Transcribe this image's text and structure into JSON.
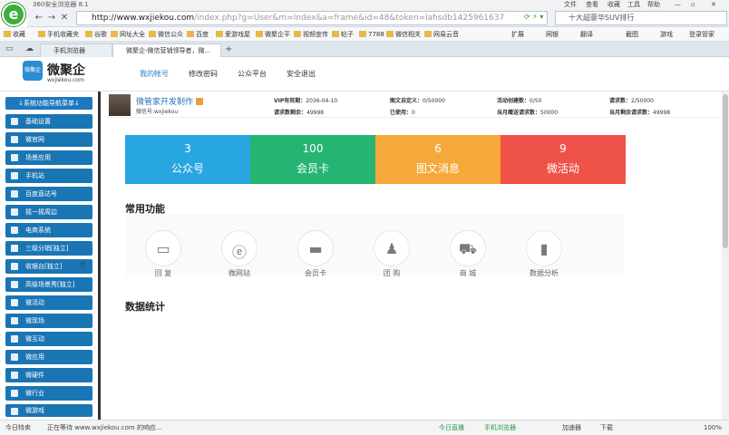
{
  "titlebar": {
    "app_title": "360安全浏览器 8.1",
    "menus": [
      "文件",
      "查看",
      "收藏",
      "工具",
      "帮助"
    ]
  },
  "browser": {
    "url_host": "http://www.wxjiekou.com",
    "url_path": "/index.php?g=User&m=Index&a=frame&id=48&token=lahsdb1425961637",
    "search_text": "十大超豪华SUV排行",
    "bookmarks": [
      "收藏",
      "手机收藏夹",
      "谷歌",
      "网址大全",
      "微信公众",
      "百度",
      "爱游戏屋",
      "微聚企平",
      "视频宣传",
      "帖子",
      "7788",
      "微信相关",
      "网易云音"
    ],
    "right_tools": [
      "扩展",
      "网银",
      "翻译",
      "截图",
      "游戏",
      "登录管家"
    ],
    "tabs": [
      {
        "label": "手机浏览器"
      },
      {
        "label": "微聚企-微信营销领导者，微..."
      }
    ]
  },
  "site": {
    "brand_badge": "微聚企",
    "brand_name": "微聚企",
    "brand_url": "wxjiekou.com",
    "nav": [
      "我的帐号",
      "修改密码",
      "公众平台",
      "安全退出"
    ]
  },
  "sidebar": {
    "header": "↓系统功能导航菜单↓",
    "items": [
      "基础设置",
      "微官网",
      "场景应用",
      "手机站",
      "百度直达号",
      "摇一摇周边",
      "电商系统",
      "三级分销[独立]",
      "收银台[独立]",
      "高级场景秀[独立]",
      "微活动",
      "微现场",
      "微互动",
      "微应用",
      "微硬件",
      "微行业",
      "微游戏"
    ]
  },
  "account": {
    "name": "微管家开发制作",
    "wx_id": "微信号:wxjiekou",
    "stats": [
      {
        "label": "VIP有效期：",
        "value": "2036-04-10"
      },
      {
        "label": "请求数剩余：",
        "value": "49998"
      },
      {
        "label": "图文自定义：",
        "value": "0/50000"
      },
      {
        "label": "已使用：",
        "value": "0"
      },
      {
        "label": "活动创建数：",
        "value": "0/50"
      },
      {
        "label": "当月赠送请求数：",
        "value": "50000"
      },
      {
        "label": "请求数：",
        "value": "2/50000"
      },
      {
        "label": "当月剩余请求数：",
        "value": "49998"
      }
    ]
  },
  "summary_cards": [
    {
      "count": "3",
      "label": "公众号",
      "color": "#27a6e0"
    },
    {
      "count": "100",
      "label": "会员卡",
      "color": "#25b573"
    },
    {
      "count": "6",
      "label": "图文消息",
      "color": "#f6a93b"
    },
    {
      "count": "9",
      "label": "微活动",
      "color": "#ee5248"
    }
  ],
  "sections": {
    "common": "常用功能",
    "stats": "数据统计"
  },
  "functions": [
    {
      "label": "回 复",
      "icon": "chat-icon"
    },
    {
      "label": "微网站",
      "icon": "e-site-icon"
    },
    {
      "label": "会员卡",
      "icon": "card-icon"
    },
    {
      "label": "团 购",
      "icon": "group-icon"
    },
    {
      "label": "商 城",
      "icon": "cart-icon"
    },
    {
      "label": "数据分析",
      "icon": "bar-chart-icon"
    }
  ],
  "statusbar": {
    "left": [
      "今日特卖",
      "正在等待 www.wxjiekou.com 的响应..."
    ],
    "right": [
      "今日直播",
      "手机浏览器",
      "加速器",
      "下载",
      "100%"
    ]
  }
}
